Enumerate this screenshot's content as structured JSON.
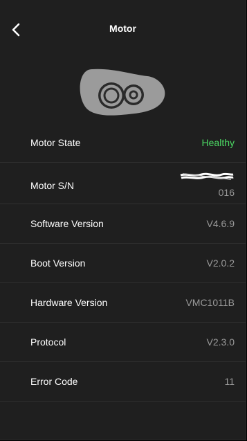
{
  "header": {
    "title": "Motor"
  },
  "items": [
    {
      "label": "Motor State",
      "value": "Healthy"
    },
    {
      "label": "Motor S/N",
      "value": "016"
    },
    {
      "label": "Software Version",
      "value": "V4.6.9"
    },
    {
      "label": "Boot Version",
      "value": "V2.0.2"
    },
    {
      "label": "Hardware Version",
      "value": "VMC1011B"
    },
    {
      "label": "Protocol",
      "value": "V2.3.0"
    },
    {
      "label": "Error Code",
      "value": "11"
    }
  ],
  "colors": {
    "background": "#1f1f1f",
    "healthy": "#4cd964",
    "value_text": "#9a9a9a",
    "divider": "#303030"
  },
  "icons": {
    "back": "chevron-left-icon",
    "motor": "motor-icon"
  }
}
